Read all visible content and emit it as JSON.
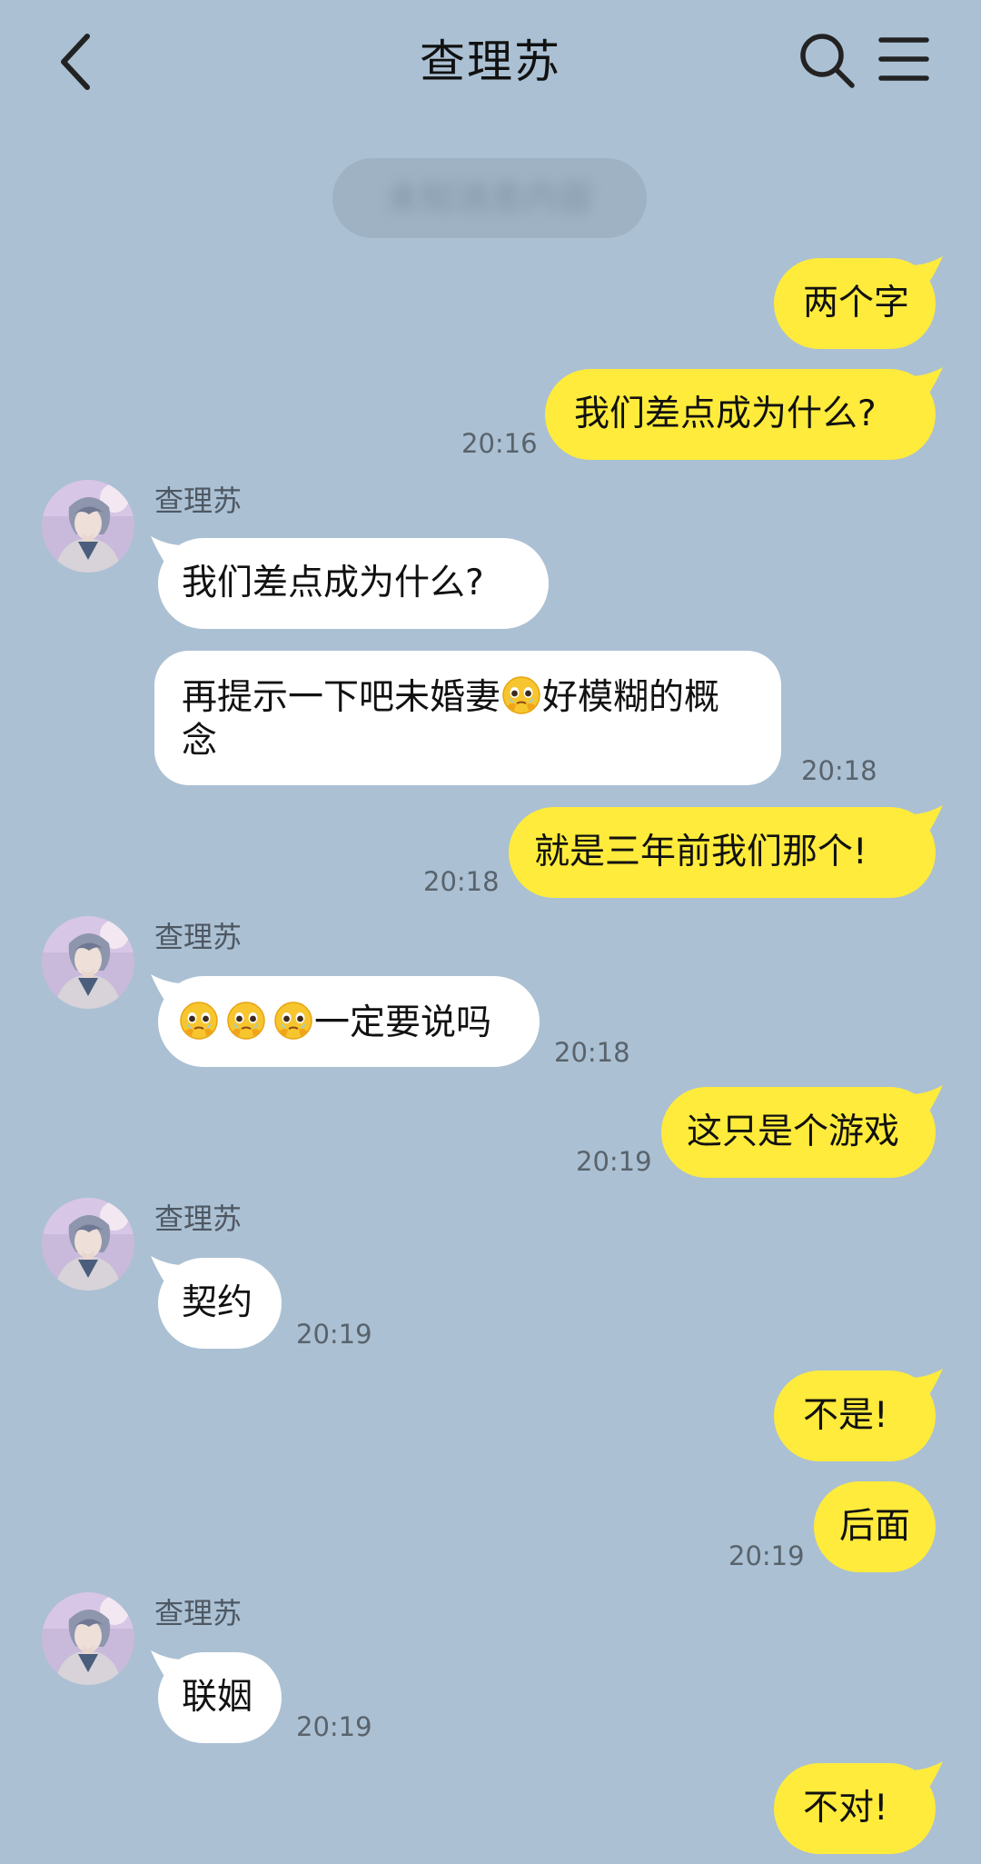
{
  "header": {
    "title": "查理苏",
    "back_icon": "chevron-left-icon",
    "search_icon": "search-icon",
    "menu_icon": "menu-icon"
  },
  "notice": {
    "text": "未知消息内容"
  },
  "contact": {
    "name": "查理苏"
  },
  "colors": {
    "background": "#abc0d3",
    "outgoing_bubble": "#ffeb3b",
    "incoming_bubble": "#ffffff",
    "timestamp": "#59636c"
  },
  "messages": [
    {
      "direction": "out",
      "text": "两个字"
    },
    {
      "direction": "out",
      "text": "我们差点成为什么?",
      "time": "20:16"
    },
    {
      "direction": "in",
      "sender": "查理苏",
      "text": "我们差点成为什么?"
    },
    {
      "direction": "in",
      "text_before": "再提示一下吧未婚妻",
      "emoji": "pleading-face-emoji",
      "text_after": "好模糊的概念",
      "time": "20:18"
    },
    {
      "direction": "out",
      "text": "就是三年前我们那个!",
      "time": "20:18"
    },
    {
      "direction": "in",
      "sender": "查理苏",
      "emoji": "pleading-face-emoji",
      "emoji_count": 3,
      "text": "一定要说吗",
      "time": "20:18"
    },
    {
      "direction": "out",
      "text": "这只是个游戏",
      "time": "20:19"
    },
    {
      "direction": "in",
      "sender": "查理苏",
      "text": "契约",
      "time": "20:19"
    },
    {
      "direction": "out",
      "text": "不是!"
    },
    {
      "direction": "out",
      "text": "后面",
      "time": "20:19"
    },
    {
      "direction": "in",
      "sender": "查理苏",
      "text": "联姻",
      "time": "20:19"
    },
    {
      "direction": "out",
      "text": "不对!"
    }
  ]
}
